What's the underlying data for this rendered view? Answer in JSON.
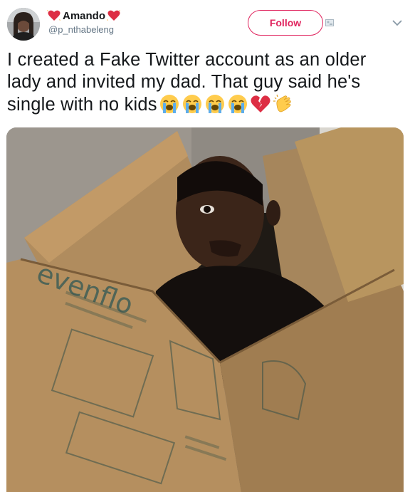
{
  "user": {
    "display_name": "Amando",
    "handle": "@p_nthabeleng"
  },
  "actions": {
    "follow_label": "Follow"
  },
  "tweet": {
    "text": "I created a Fake Twitter account as an older lady and invited my dad. That guy said he's single with no kids"
  },
  "emojis": [
    "loudly-crying-face",
    "loudly-crying-face",
    "loudly-crying-face",
    "loudly-crying-face",
    "broken-heart",
    "clapping-hands"
  ],
  "photo": {
    "box_brand": "evenflo"
  },
  "colors": {
    "accent": "#e0245e",
    "secondary_text": "#657786",
    "primary_text": "#14171a"
  }
}
